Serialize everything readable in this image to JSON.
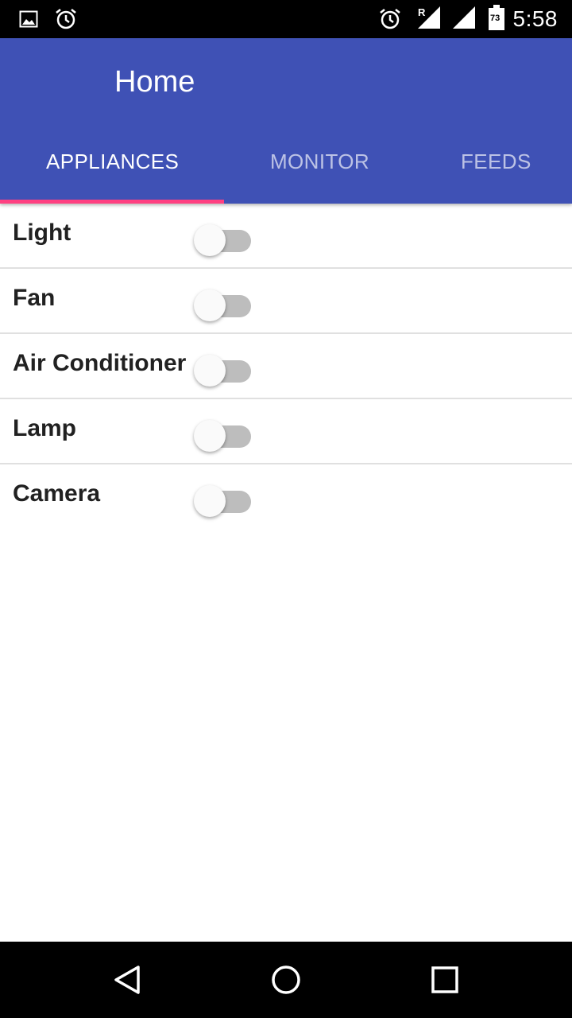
{
  "status_bar": {
    "time": "5:58",
    "battery_level": "73",
    "roaming_indicator": "R",
    "left_icons": [
      "image-icon",
      "alarm-clock-icon"
    ],
    "right_icons": [
      "alarm-clock-icon",
      "signal-roaming-icon",
      "signal-icon",
      "battery-icon"
    ]
  },
  "app_bar": {
    "title": "Home",
    "color": "#3f51b5",
    "indicator_color": "#ff4081"
  },
  "tabs": [
    {
      "label": "APPLIANCES",
      "active": true
    },
    {
      "label": "MONITOR",
      "active": false
    },
    {
      "label": "FEEDS",
      "active": false
    }
  ],
  "appliances": [
    {
      "label": "Light",
      "on": false
    },
    {
      "label": "Fan",
      "on": false
    },
    {
      "label": "Air Conditioner",
      "on": false
    },
    {
      "label": "Lamp",
      "on": false
    },
    {
      "label": "Camera",
      "on": false
    }
  ],
  "nav_bar": {
    "buttons": [
      "back-icon",
      "home-icon",
      "recents-icon"
    ]
  }
}
